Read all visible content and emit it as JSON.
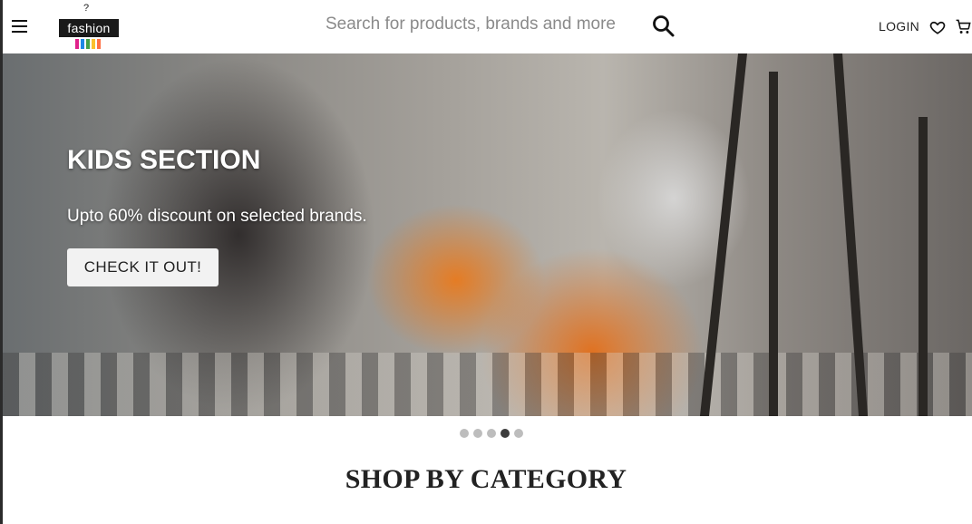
{
  "header": {
    "logo_text": "fashion",
    "search_placeholder": "Search for products, brands and more",
    "login_label": "LOGIN",
    "icons": {
      "menu": "hamburger-menu-icon",
      "search": "search-icon",
      "wishlist": "heart-icon",
      "cart": "shopping-cart-icon"
    }
  },
  "hero": {
    "title": "KIDS SECTION",
    "subtitle": "Upto 60% discount on selected brands.",
    "cta_label": "CHECK IT OUT!",
    "slide_count": 5,
    "active_slide": 4
  },
  "section": {
    "title": "SHOP BY CATEGORY"
  },
  "colors": {
    "logo_stripes": [
      "#e0218a",
      "#1e88e5",
      "#43a047",
      "#fbc02d",
      "#ff7043"
    ]
  }
}
